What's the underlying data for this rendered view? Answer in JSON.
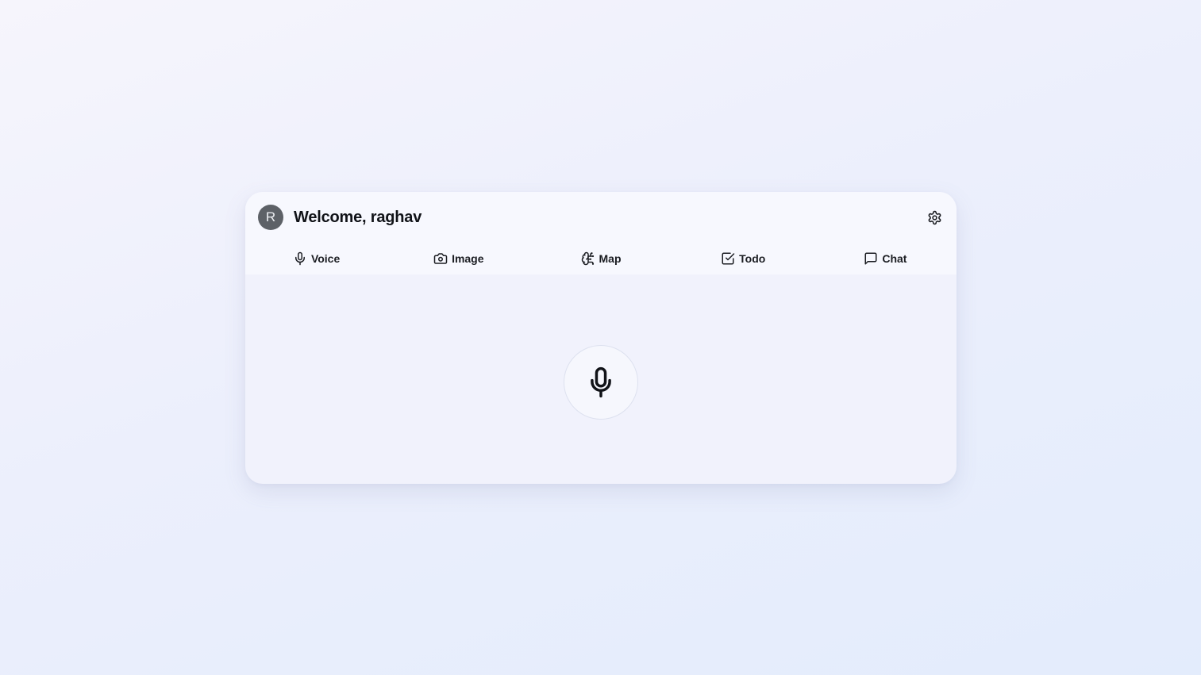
{
  "header": {
    "avatar_initial": "R",
    "welcome_text": "Welcome, raghav",
    "settings_icon": "gear-icon"
  },
  "tabs": [
    {
      "label": "Voice",
      "icon": "microphone-icon"
    },
    {
      "label": "Image",
      "icon": "camera-icon"
    },
    {
      "label": "Map",
      "icon": "brain-map-icon"
    },
    {
      "label": "Todo",
      "icon": "checkbox-icon"
    },
    {
      "label": "Chat",
      "icon": "chat-bubble-icon"
    }
  ],
  "main": {
    "record_button_icon": "microphone-icon"
  },
  "colors": {
    "avatar_bg": "#5d6167",
    "text": "#111318",
    "card_bg": "#f1f2fc"
  }
}
